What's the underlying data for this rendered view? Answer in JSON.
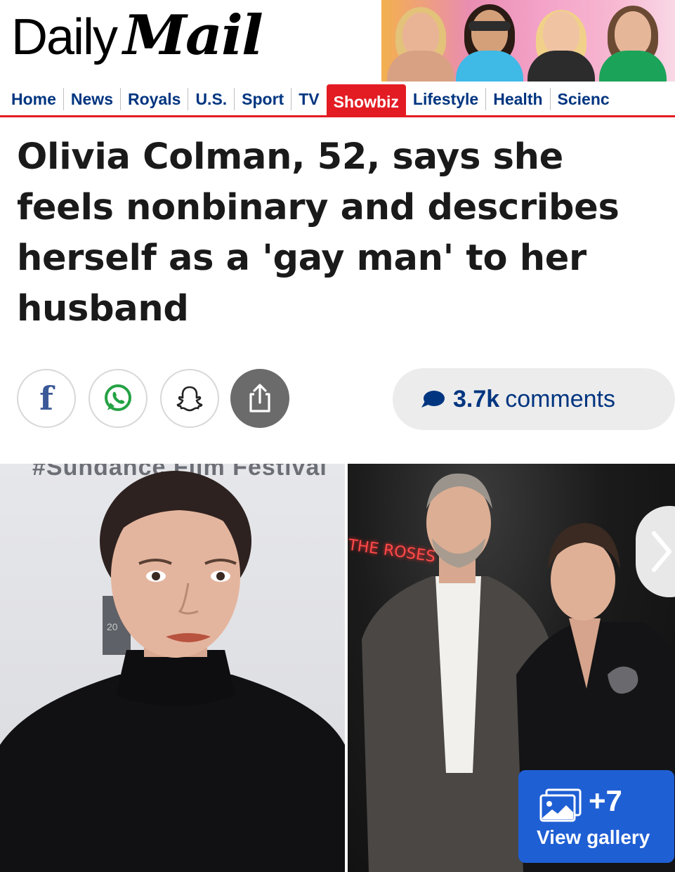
{
  "brand": {
    "daily": "Daily",
    "mail": "Mail"
  },
  "promo": {
    "celebs": [
      "celeb-1",
      "celeb-2",
      "celeb-3",
      "celeb-4"
    ]
  },
  "nav": {
    "items": [
      "Home",
      "News",
      "Royals",
      "U.S.",
      "Sport",
      "TV",
      "Showbiz",
      "Lifestyle",
      "Health",
      "Scienc"
    ],
    "active": "Showbiz"
  },
  "article": {
    "headline": "Olivia Colman, 52, says she feels nonbinary and describes herself as a 'gay man' to her husband"
  },
  "share": {
    "facebook_icon": "f",
    "buttons": [
      "facebook-icon",
      "whatsapp-icon",
      "snapchat-icon",
      "share-upload-icon"
    ]
  },
  "comments": {
    "count": "3.7k",
    "label": "comments"
  },
  "photos": {
    "left_backdrop_text": "#Sundance Film Festival",
    "left_badge_text": "20",
    "right_neon_text": "THE ROSES"
  },
  "gallery": {
    "count": "+7",
    "label": "View gallery"
  },
  "colors": {
    "nav_text": "#003580",
    "accent_red": "#e31c23",
    "gallery_blue": "#1f5fd4",
    "comments_bg": "#ececec"
  }
}
